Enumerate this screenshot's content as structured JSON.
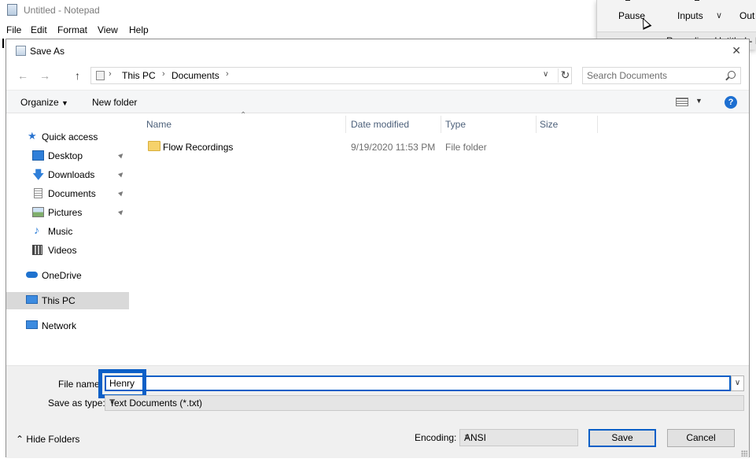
{
  "notepad": {
    "title": "Untitled - Notepad",
    "menu": [
      "File",
      "Edit",
      "Format",
      "View",
      "Help"
    ]
  },
  "recorder": {
    "pause_label": "Pause",
    "inputs_label": "Inputs",
    "out_label": "Out",
    "status": "Recording: Untitled - I"
  },
  "dialog": {
    "title": "Save As",
    "address": {
      "crumbs": [
        "This PC",
        "Documents"
      ]
    },
    "search": {
      "placeholder": "Search Documents"
    },
    "toolbar": {
      "organize": "Organize",
      "new_folder": "New folder",
      "help": "?"
    },
    "nav": {
      "quick_access": "Quick access",
      "desktop": "Desktop",
      "downloads": "Downloads",
      "documents": "Documents",
      "pictures": "Pictures",
      "music": "Music",
      "videos": "Videos",
      "onedrive": "OneDrive",
      "this_pc": "This PC",
      "network": "Network"
    },
    "columns": {
      "name": "Name",
      "date": "Date modified",
      "type": "Type",
      "size": "Size"
    },
    "files": [
      {
        "name": "Flow Recordings",
        "date": "9/19/2020 11:53 PM",
        "type": "File folder",
        "size": ""
      }
    ],
    "file_name_label": "File name:",
    "file_name_value": "Henry",
    "save_as_type_label": "Save as type:",
    "save_as_type_value": "Text Documents (*.txt)",
    "hide_folders": "Hide Folders",
    "encoding_label": "Encoding:",
    "encoding_value": "ANSI",
    "save_button": "Save",
    "cancel_button": "Cancel"
  },
  "colors": {
    "accent": "#0b5fc7",
    "folder": "#f6d26b",
    "header_text": "#4c607a"
  }
}
